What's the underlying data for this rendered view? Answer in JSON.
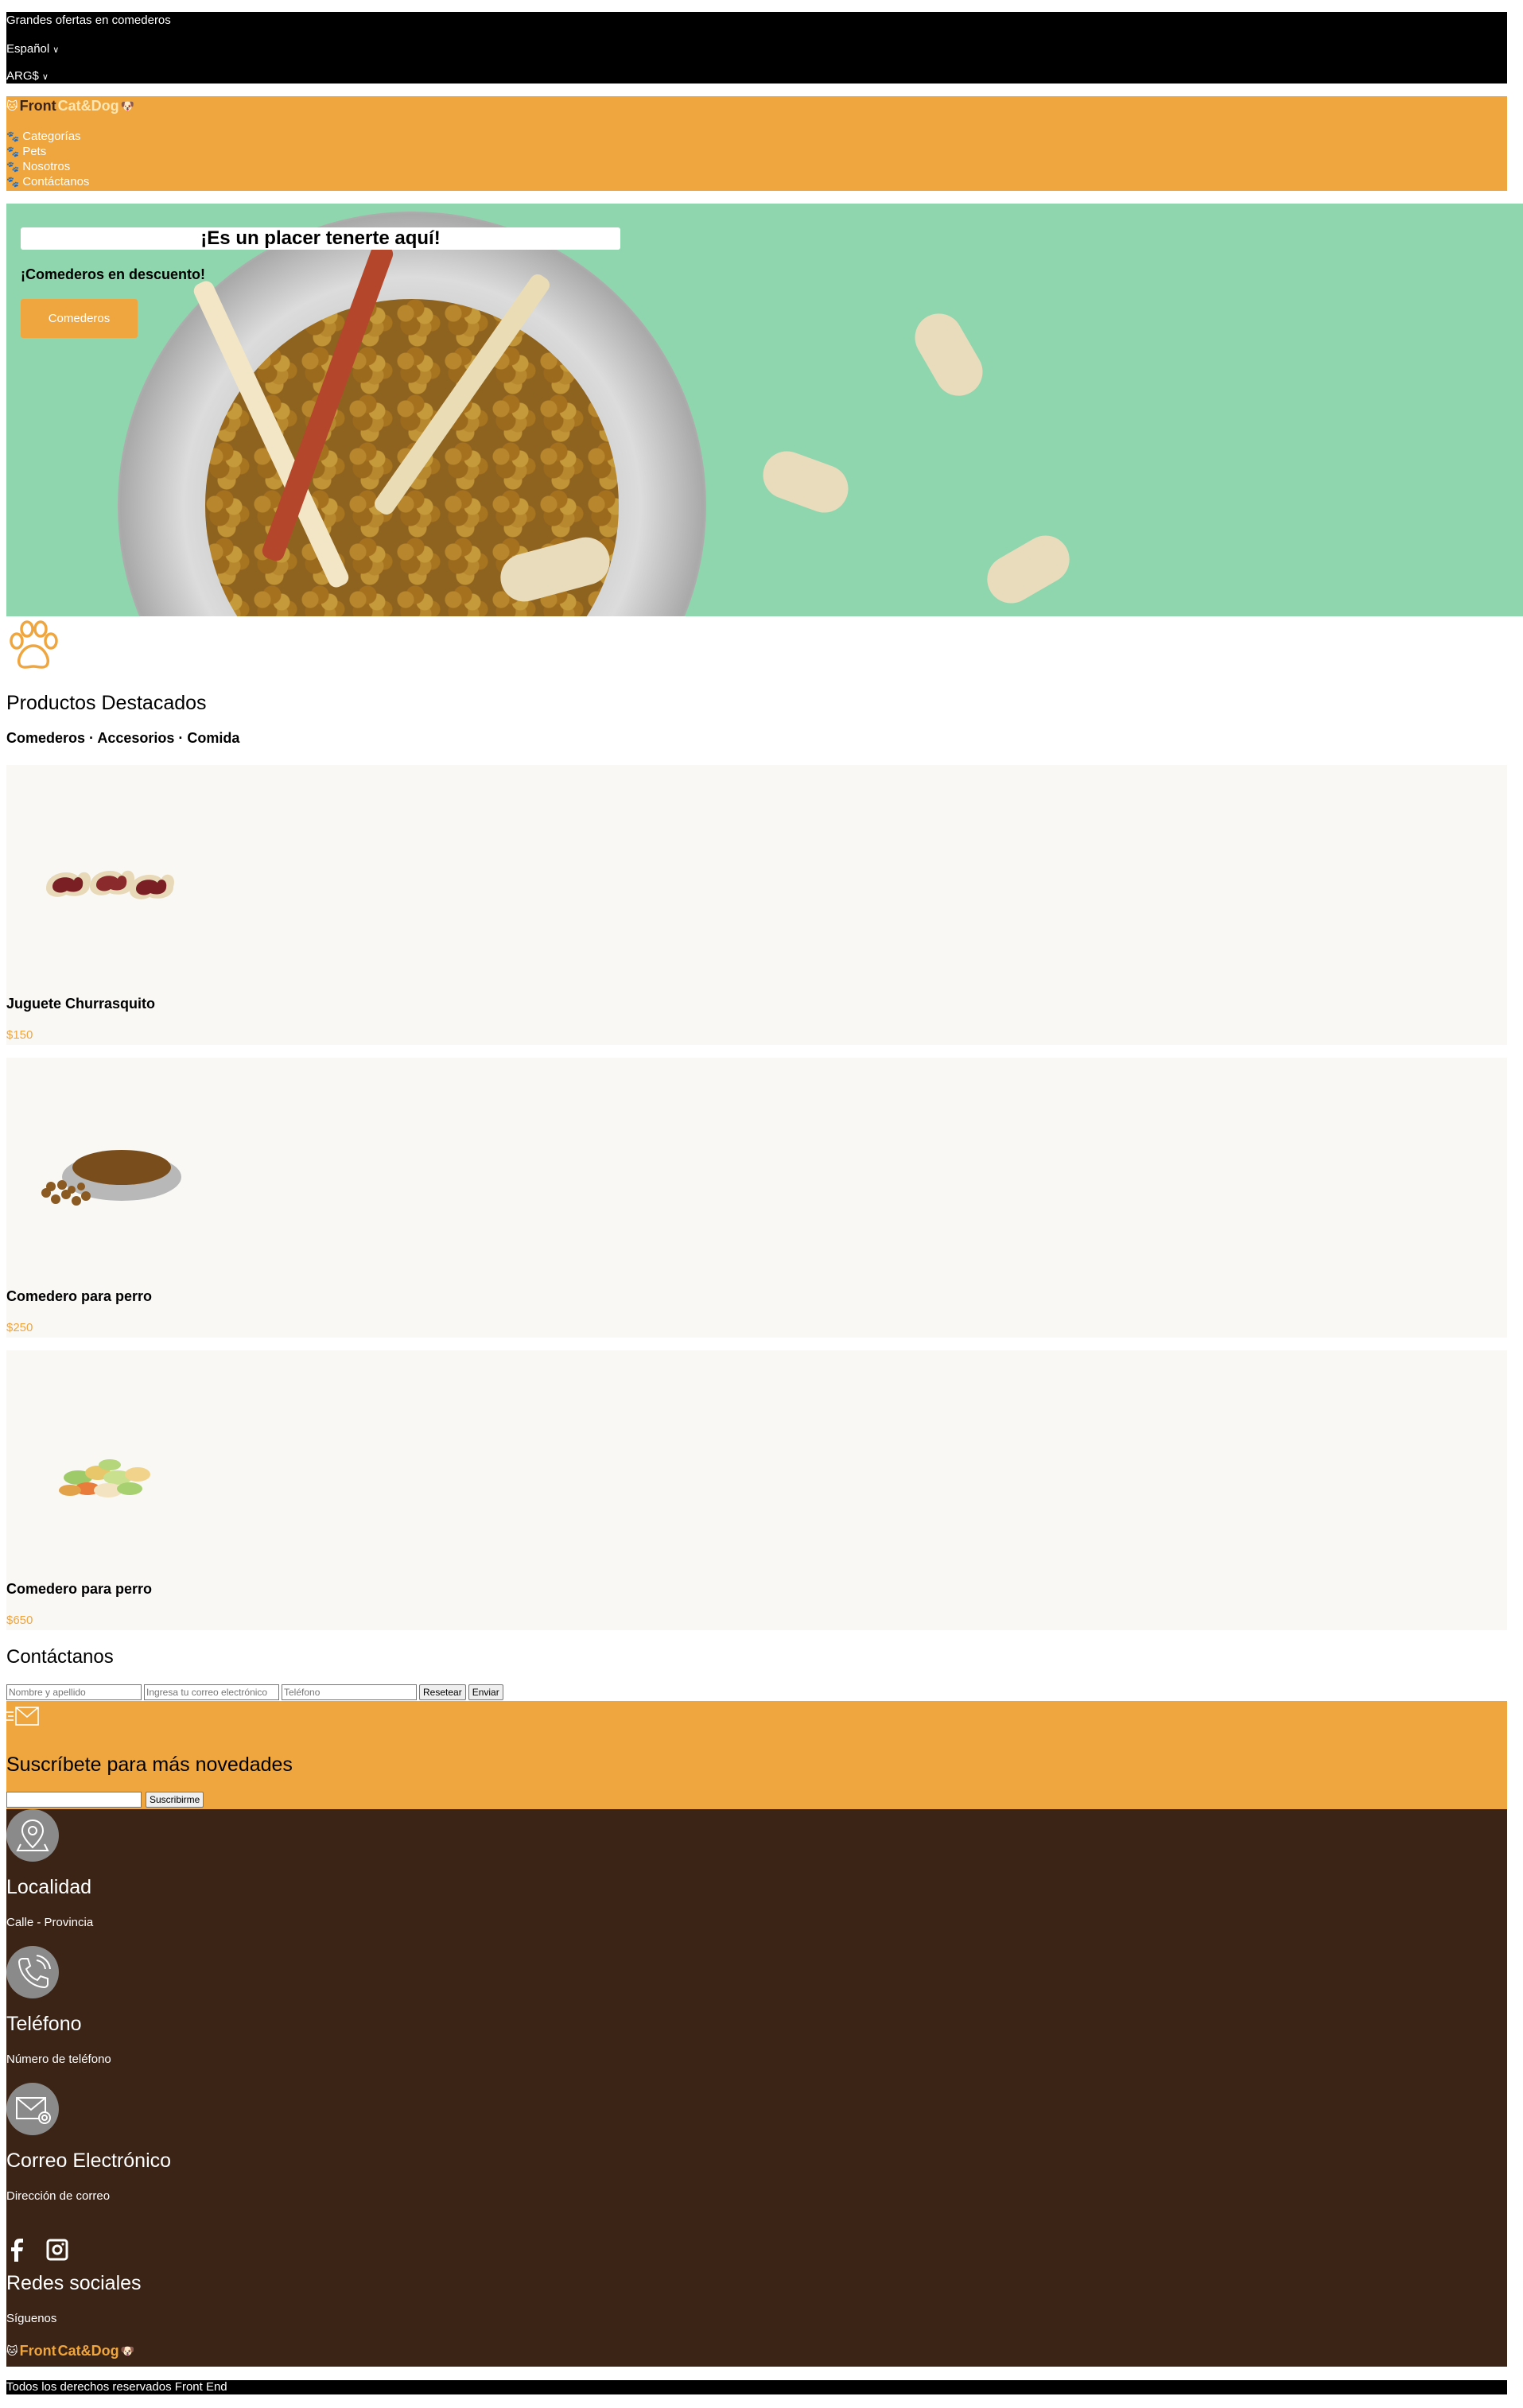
{
  "topbar": {
    "promo": "Grandes ofertas en comederos",
    "language": "Español",
    "currency": "ARG$",
    "caret": "∨"
  },
  "header": {
    "logo_front": "Front",
    "logo_catdog": "Cat&Dog",
    "nav": [
      "Categorías",
      "Pets",
      "Nosotros",
      "Contáctanos"
    ]
  },
  "hero": {
    "title": "¡Es un placer tenerte aquí!",
    "subtitle": "¡Comederos en descuento!",
    "button": "Comederos"
  },
  "featured": {
    "title": "Productos Destacados",
    "categories": "Comederos · Accesorios · Comida",
    "products": [
      {
        "name": "Juguete Churrasquito",
        "price": "$150"
      },
      {
        "name": "Comedero para perro",
        "price": "$250"
      },
      {
        "name": "Comedero para perro",
        "price": "$650"
      }
    ]
  },
  "contact": {
    "title": "Contáctanos",
    "name_placeholder": "Nombre y apellido",
    "email_placeholder": "Ingresa tu correo electrónico",
    "phone_placeholder": "Teléfono",
    "reset_label": "Resetear",
    "send_label": "Enviar"
  },
  "subscribe": {
    "title": "Suscríbete para más novedades",
    "button": "Suscribirme"
  },
  "footer": {
    "location_title": "Localidad",
    "location_text": "Calle - Provincia",
    "phone_title": "Teléfono",
    "phone_text": "Número de teléfono",
    "email_title": "Correo Electrónico",
    "email_text": "Dirección de correo",
    "social_title": "Redes sociales",
    "social_text": "Síguenos",
    "logo_front": "Front",
    "logo_catdog": "Cat&Dog",
    "copyright": "Todos los derechos reservados Front End"
  },
  "colors": {
    "accent": "#f0a63f",
    "footer_bg": "#3b2315",
    "hero_bg": "#8fd6ae",
    "card_bg": "#f9f8f4"
  },
  "icons": [
    "paw-icon",
    "mail-icon",
    "location-icon",
    "phone-icon",
    "email-icon",
    "facebook-icon",
    "instagram-icon"
  ]
}
